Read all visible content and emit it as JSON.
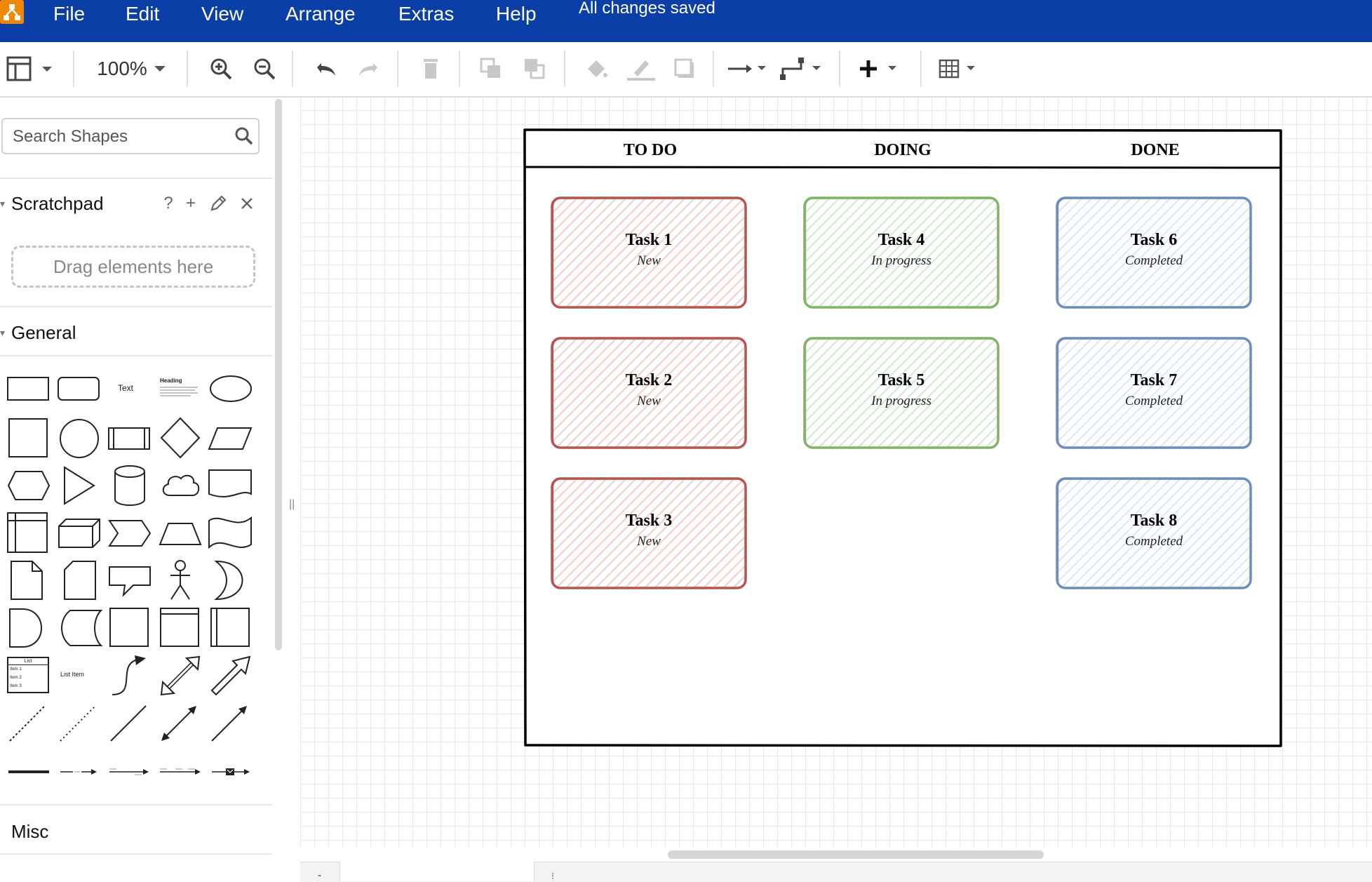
{
  "app": {
    "menu": [
      "File",
      "Edit",
      "View",
      "Arrange",
      "Extras",
      "Help"
    ],
    "status": "All changes saved",
    "brand_color": "#0b3fa8",
    "logo_color": "#f08705"
  },
  "toolbar": {
    "zoom": "100%",
    "icons": [
      "format-panel-icon",
      "zoom-in-icon",
      "zoom-out-icon",
      "undo-icon",
      "redo-icon",
      "delete-icon",
      "to-front-icon",
      "to-back-icon",
      "fill-color-icon",
      "line-color-icon",
      "shadow-icon",
      "connection-icon",
      "waypoints-icon",
      "insert-icon",
      "table-icon"
    ]
  },
  "sidebar": {
    "search_placeholder": "Search Shapes",
    "scratchpad": {
      "title": "Scratchpad",
      "help": "?",
      "drop_hint": "Drag elements here"
    },
    "general_title": "General",
    "misc_title": "Misc",
    "shape_labels": {
      "text": "Text",
      "heading": "Heading",
      "list": "List",
      "list_items": [
        "Item 1",
        "Item 2",
        "Item 3"
      ],
      "list_item": "List Item"
    }
  },
  "board": {
    "columns": [
      "TO DO",
      "DOING",
      "DONE"
    ],
    "cards": [
      {
        "title": "Task 1",
        "status": "New",
        "stroke": "#b85450",
        "fill": "#f8cecc"
      },
      {
        "title": "Task 2",
        "status": "New",
        "stroke": "#b85450",
        "fill": "#f8cecc"
      },
      {
        "title": "Task 3",
        "status": "New",
        "stroke": "#b85450",
        "fill": "#f8cecc"
      },
      {
        "title": "Task 4",
        "status": "In progress",
        "stroke": "#82b366",
        "fill": "#d5e8d4"
      },
      {
        "title": "Task 5",
        "status": "In progress",
        "stroke": "#82b366",
        "fill": "#d5e8d4"
      },
      {
        "title": "Task 6",
        "status": "Completed",
        "stroke": "#6c8ebf",
        "fill": "#dae8fc"
      },
      {
        "title": "Task 7",
        "status": "Completed",
        "stroke": "#6c8ebf",
        "fill": "#dae8fc"
      },
      {
        "title": "Task 8",
        "status": "Completed",
        "stroke": "#6c8ebf",
        "fill": "#dae8fc"
      }
    ]
  }
}
